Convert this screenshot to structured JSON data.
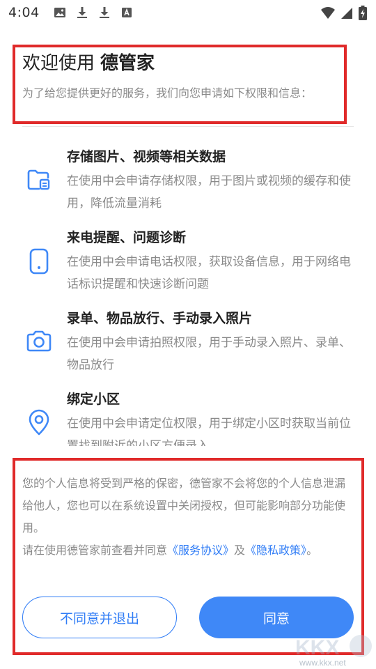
{
  "status_bar": {
    "time": "4:04",
    "left_icons": [
      "image-icon",
      "download-icon",
      "download-icon",
      "text-a-icon"
    ],
    "right_icons": [
      "wifi-icon",
      "signal-icon",
      "battery-charging-icon"
    ]
  },
  "header": {
    "title_prefix": "欢迎使用",
    "brand": "德管家",
    "subtitle": "为了给您提供更好的服务，我们向您申请如下权限和信息："
  },
  "permissions": [
    {
      "icon": "folder-doc-icon",
      "title": "存储图片、视频等相关数据",
      "desc": "在使用中会申请存储权限，用于图片或视频的缓存和使用，降低流量消耗"
    },
    {
      "icon": "phone-icon",
      "title": "来电提醒、问题诊断",
      "desc": "在使用中会申请电话权限，获取设备信息，用于网络电话标识提醒和快速诊断问题"
    },
    {
      "icon": "camera-icon",
      "title": "录单、物品放行、手动录入照片",
      "desc": "在使用中会申请拍照权限，用于手动录入照片、录单、物品放行"
    },
    {
      "icon": "location-pin-icon",
      "title": "绑定小区",
      "desc": "在使用中会申请定位权限，用于绑定小区时获取当前位置找到附近的小区方便录入"
    }
  ],
  "notice": {
    "paragraph1": "您的个人信息将受到严格的保密，德管家不会将您的个人信息泄漏给他人，您也可以在系统设置中关闭授权，但可能影响部分功能使用。",
    "paragraph2_prefix": "请在使用德管家前查看并同意",
    "service_link": "《服务协议》",
    "and_text": "及",
    "privacy_link": "《隐私政策》",
    "paragraph2_suffix": "。"
  },
  "buttons": {
    "disagree": "不同意并退出",
    "agree": "同意"
  },
  "watermark": {
    "logo_text": "KKX下载",
    "url": "www.kkx.net"
  },
  "colors": {
    "accent": "#3f88f7",
    "link": "#2f7cf6",
    "highlight_border": "#e02a2a"
  }
}
